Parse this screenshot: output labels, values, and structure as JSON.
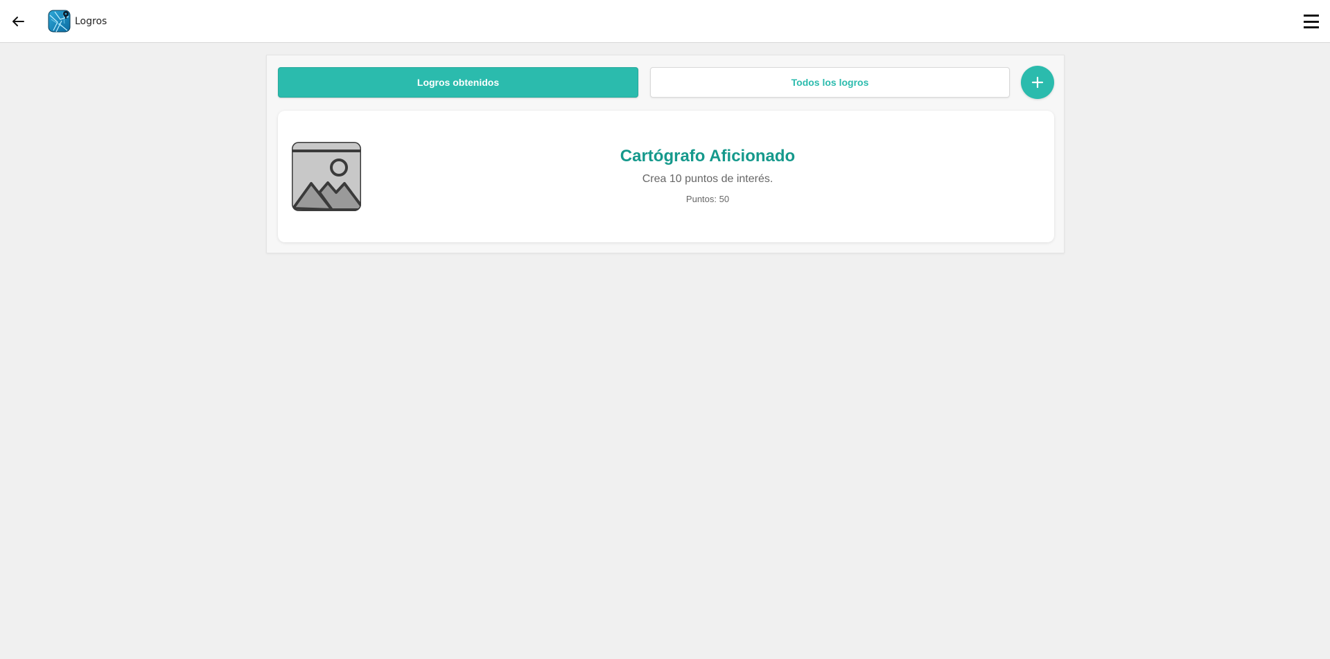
{
  "header": {
    "title": "Logros",
    "back_icon": "arrow-left-icon",
    "logo_icon": "app-logo-icon",
    "menu_icon": "hamburger-menu-icon"
  },
  "tabs": {
    "obtained_label": "Logros obtenidos",
    "all_label": "Todos los logros",
    "active": "obtained"
  },
  "add_button": {
    "icon": "plus-icon"
  },
  "achievements": [
    {
      "image_icon": "image-placeholder-icon",
      "title": "Cartógrafo Aficionado",
      "description": "Crea 10 puntos de interés.",
      "points": "Puntos: 50"
    }
  ],
  "colors": {
    "accent": "#2bbbad",
    "title_accent": "#15998c",
    "background": "#f0f0f0"
  }
}
